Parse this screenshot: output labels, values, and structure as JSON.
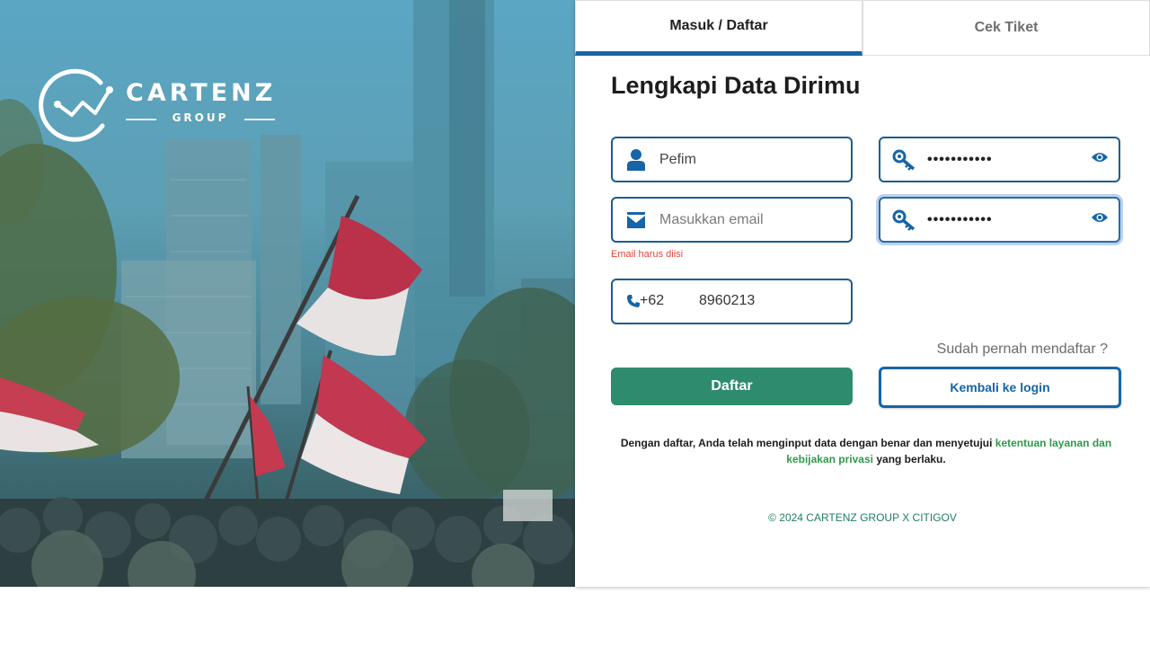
{
  "brand": {
    "name": "CARTENZ",
    "sub": "GROUP"
  },
  "tabs": [
    {
      "label": "Masuk / Daftar",
      "active": true
    },
    {
      "label": "Cek Tiket",
      "active": false
    }
  ],
  "form": {
    "title": "Lengkapi Data Dirimu",
    "name_value": "Pefim",
    "email_placeholder": "Masukkan email",
    "email_error": "Email harus diisi",
    "password_mask": "•••••••••••",
    "confirm_password_mask": "•••••••••••",
    "phone_prefix": "+62",
    "phone_value": "8960213",
    "already_registered": "Sudah pernah mendaftar ?",
    "register_button": "Daftar",
    "back_login_button": "Kembali ke login"
  },
  "terms": {
    "prefix": "Dengan daftar, Anda telah menginput data dengan benar dan menyetujui",
    "link1": "ketentuan layanan dan",
    "link2": "kebijakan privasi",
    "suffix": "yang berlaku."
  },
  "footer": "© 2024 CARTENZ GROUP X CITIGOV",
  "colors": {
    "primary_blue": "#1565a7",
    "green": "#2e8b6e",
    "error_red": "#e0463d",
    "link_green": "#2e9a4a"
  },
  "icons": {
    "name": "user-icon",
    "email": "envelope-icon",
    "password": "key-icon",
    "toggle": "eye-icon",
    "phone": "phone-icon"
  }
}
